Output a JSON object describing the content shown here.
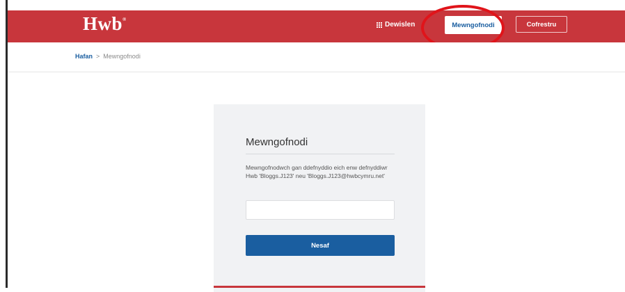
{
  "header": {
    "logo": "Hwb",
    "logo_mark": "®",
    "apps_label": "Dewislen",
    "login_label": "Mewngofnodi",
    "register_label": "Cofrestru",
    "brand_color": "#c8363c",
    "annotation_color": "#e0141a"
  },
  "breadcrumb": {
    "home": "Hafan",
    "separator": ">",
    "current": "Mewngofnodi"
  },
  "login": {
    "title": "Mewngofnodi",
    "description": "Mewngofnodwch gan ddefnyddio eich enw defnyddiwr Hwb 'Bloggs.J123' neu 'Bloggs.J123@hwbcymru.net'",
    "username_value": "",
    "next_label": "Nesaf",
    "button_color": "#1a5ea0"
  },
  "icons": {
    "apps": "grid-icon"
  }
}
